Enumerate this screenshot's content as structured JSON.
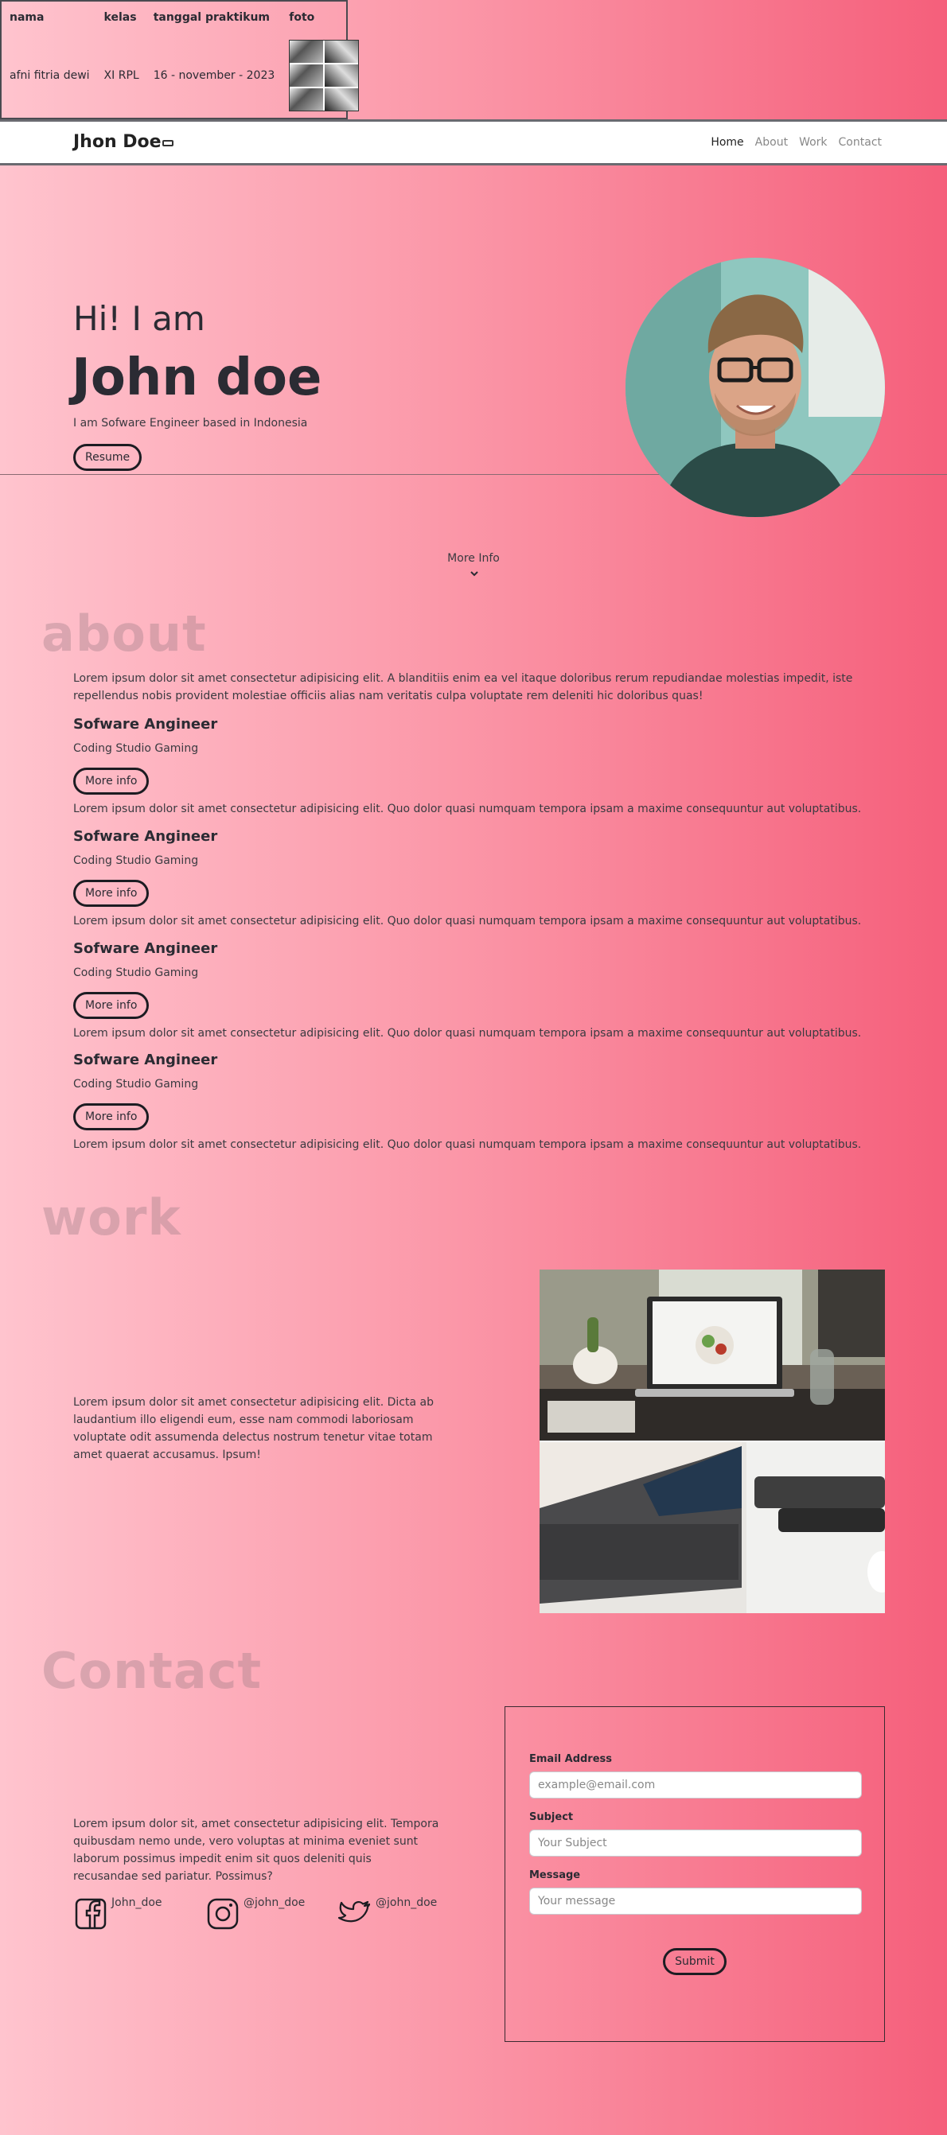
{
  "student": {
    "headers": {
      "nama": "nama",
      "kelas": "kelas",
      "tanggal": "tanggal praktikum",
      "foto": "foto"
    },
    "values": {
      "nama": "afni fitria dewi",
      "kelas": "XI RPL",
      "tanggal": "16 - november - 2023"
    }
  },
  "navbar": {
    "brand": "Jhon Doe",
    "links": [
      "Home",
      "About",
      "Work",
      "Contact"
    ]
  },
  "hero": {
    "greeting": "Hi! I am",
    "name": "John doe",
    "description": "I am Sofware Engineer based in Indonesia",
    "resume_label": "Resume",
    "more_info_label": "More Info"
  },
  "about": {
    "title": "about",
    "intro": "Lorem ipsum dolor sit amet consectetur adipisicing elit. A blanditiis enim ea vel itaque doloribus rerum repudiandae molestias impedit, iste repellendus nobis provident molestiae officiis alias nam veritatis culpa voluptate rem deleniti hic doloribus quas!",
    "items": [
      {
        "title": "Sofware Angineer",
        "company": "Coding Studio Gaming",
        "button": "More info",
        "desc": "Lorem ipsum dolor sit amet consectetur adipisicing elit. Quo dolor quasi numquam tempora ipsam a maxime consequuntur aut voluptatibus."
      },
      {
        "title": "Sofware Angineer",
        "company": "Coding Studio Gaming",
        "button": "More info",
        "desc": "Lorem ipsum dolor sit amet consectetur adipisicing elit. Quo dolor quasi numquam tempora ipsam a maxime consequuntur aut voluptatibus."
      },
      {
        "title": "Sofware Angineer",
        "company": "Coding Studio Gaming",
        "button": "More info",
        "desc": "Lorem ipsum dolor sit amet consectetur adipisicing elit. Quo dolor quasi numquam tempora ipsam a maxime consequuntur aut voluptatibus."
      },
      {
        "title": "Sofware Angineer",
        "company": "Coding Studio Gaming",
        "button": "More info",
        "desc": "Lorem ipsum dolor sit amet consectetur adipisicing elit. Quo dolor quasi numquam tempora ipsam a maxime consequuntur aut voluptatibus."
      }
    ]
  },
  "work": {
    "title": "work",
    "text": "Lorem ipsum dolor sit amet consectetur adipisicing elit. Dicta ab laudantium illo eligendi eum, esse nam commodi laboriosam voluptate odit assumenda delectus nostrum tenetur vitae totam amet quaerat accusamus. Ipsum!"
  },
  "contact": {
    "title": "Contact",
    "text": "Lorem ipsum dolor sit, amet consectetur adipisicing elit. Tempora quibusdam nemo unde, vero voluptas at minima eveniet sunt laborum possimus impedit enim sit quos deleniti quis recusandae sed pariatur. Possimus?",
    "socials": [
      {
        "icon": "facebook-icon",
        "handle": "John_doe"
      },
      {
        "icon": "instagram-icon",
        "handle": "@john_doe"
      },
      {
        "icon": "twitter-icon",
        "handle": "@john_doe"
      }
    ],
    "form": {
      "email_label": "Email Address",
      "email_placeholder": "example@email.com",
      "subject_label": "Subject",
      "subject_placeholder": "Your Subject",
      "message_label": "Message",
      "message_placeholder": "Your message",
      "submit_label": "Submit"
    }
  },
  "colors": {
    "gradient_left": "#ffc4ce",
    "gradient_mid": "#fb97a8",
    "gradient_right": "#f55f7b",
    "text": "#2b2b33"
  }
}
